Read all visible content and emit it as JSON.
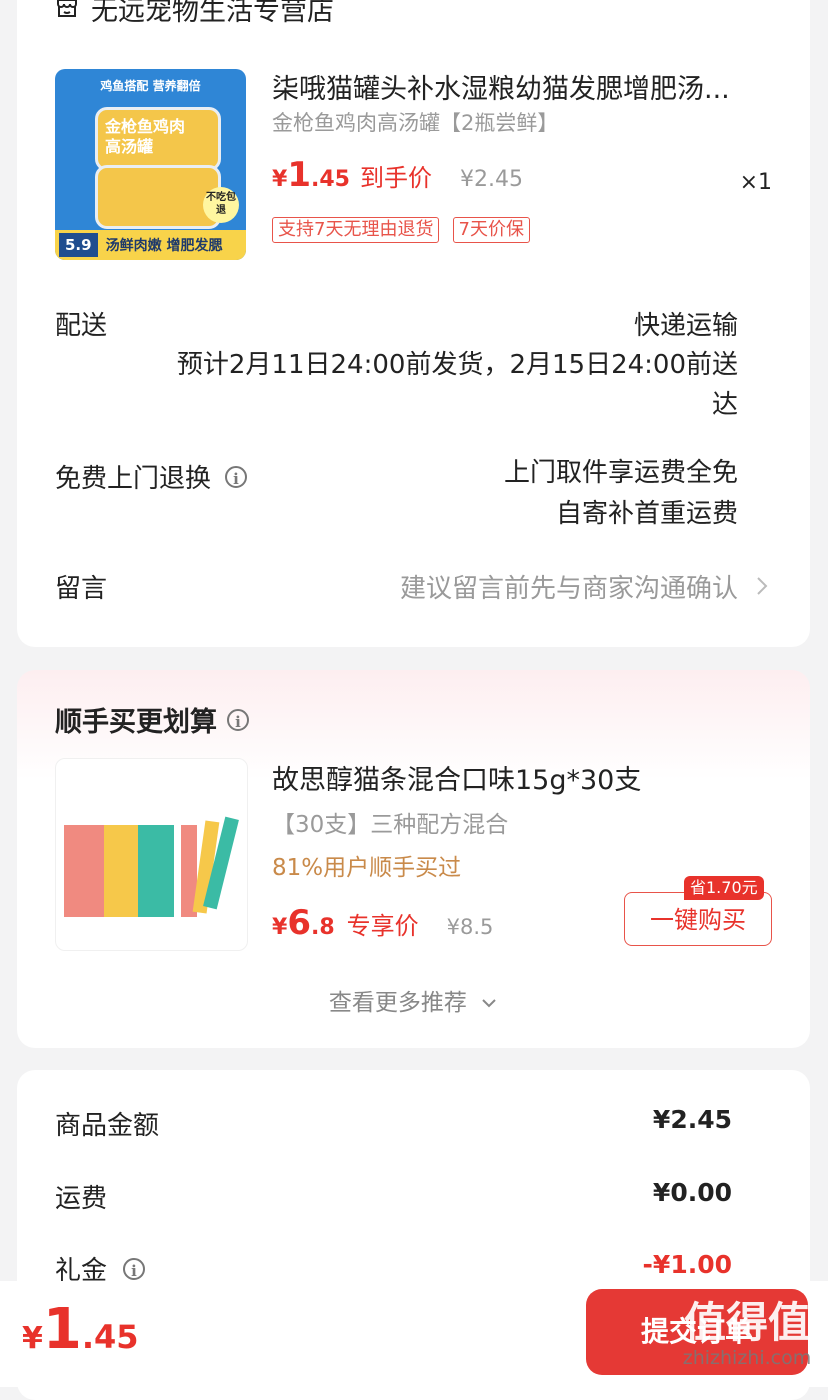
{
  "colors": {
    "price_red": "#e8322b",
    "orange": "#c98a4a",
    "button_red": "#e53935"
  },
  "store": {
    "name": "无远宠物生活专营店",
    "icon": "store-icon"
  },
  "product": {
    "title": "柒哦猫罐头补水湿粮幼猫发腮增肥汤...",
    "spec": "金枪鱼鸡肉高汤罐【2瓶尝鲜】",
    "price_symbol": "¥",
    "price_int": "1",
    "price_dec": ".45",
    "price_label": "到手价",
    "original_price": "¥2.45",
    "quantity": "×1",
    "tags": [
      "支持7天无理由退货",
      "7天价保"
    ],
    "image": {
      "top_text": "鸡鱼搭配 营养翻倍",
      "can_text": "金枪鱼鸡肉高汤罐",
      "bottom_price": "5.9",
      "bottom_text": "汤鲜肉嫩 增肥发腮",
      "badge": "不吃包退"
    }
  },
  "delivery": {
    "label": "配送",
    "method": "快递运输",
    "estimate_line1": "预计2月11日24:00前发货，2月15日24:00前送",
    "estimate_line2": "达"
  },
  "return_service": {
    "label": "免费上门退换",
    "line1": "上门取件享运费全免",
    "line2": "自寄补首重运费"
  },
  "message": {
    "label": "留言",
    "placeholder": "建议留言前先与商家沟通确认"
  },
  "upsell": {
    "title": "顺手买更划算",
    "product_title": "故思醇猫条混合口味15g*30支",
    "spec": "【30支】三种配方混合",
    "social": "81%用户顺手买过",
    "price_symbol": "¥",
    "price_int": "6",
    "price_dec": ".8",
    "price_label": "专享价",
    "original_price": "¥8.5",
    "save_badge": "省1.70元",
    "buy_button": "一键购买",
    "more": "查看更多推荐"
  },
  "summary": {
    "rows": [
      {
        "label": "商品金额",
        "value": "¥2.45"
      },
      {
        "label": "运费",
        "value": "¥0.00"
      },
      {
        "label": "礼金",
        "value": "-¥1.00"
      }
    ]
  },
  "bottom_bar": {
    "price_symbol": "¥",
    "price_int": "1",
    "price_dec": ".45",
    "submit_button": "提交订单",
    "watermark_big": "值得值",
    "watermark_url": "zhizhizhi.com"
  }
}
